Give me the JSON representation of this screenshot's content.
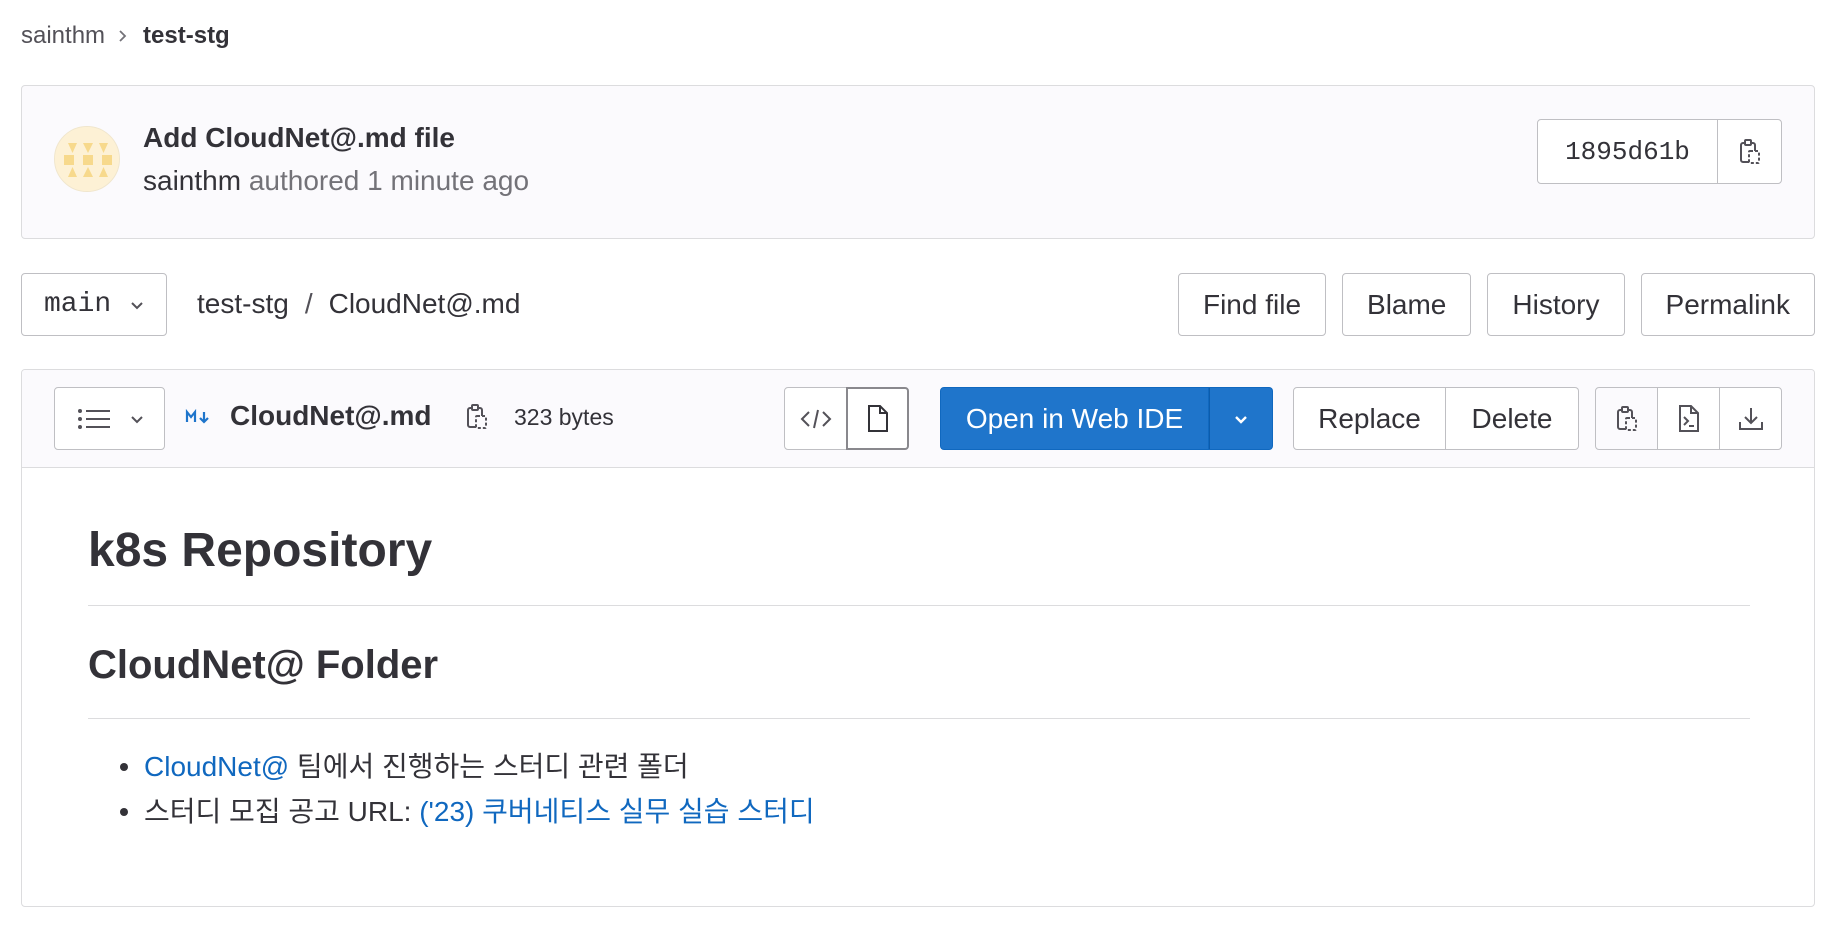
{
  "breadcrumb": {
    "parent": "sainthm",
    "current": "test-stg"
  },
  "commit": {
    "title": "Add CloudNet@.md file",
    "author": "sainthm",
    "meta": "authored 1 minute ago",
    "sha": "1895d61b"
  },
  "tree": {
    "branch": "main",
    "path_root": "test-stg",
    "path_separator": "/",
    "path_file": "CloudNet@.md",
    "actions": {
      "find_file": "Find file",
      "blame": "Blame",
      "history": "History",
      "permalink": "Permalink"
    }
  },
  "file": {
    "name": "CloudNet@.md",
    "size": "323 bytes",
    "open_web_ide": "Open in Web IDE",
    "replace": "Replace",
    "delete": "Delete"
  },
  "markdown": {
    "h1": "k8s Repository",
    "h2": "CloudNet@ Folder",
    "item1_link": "CloudNet@",
    "item1_text": " 팀에서 진행하는 스터디 관련 폴더",
    "item2_text": "스터디 모집 공고 URL: ",
    "item2_link": "('23) 쿠버네티스 실무 실습 스터디"
  },
  "colors": {
    "primary": "#1f75cb",
    "link": "#1068bf",
    "text": "#333238",
    "muted": "#737278",
    "border": "#dcdcde"
  },
  "icons": {
    "chevron": "chevron-down-icon",
    "copy": "copy-to-clipboard-icon",
    "toc": "list-bulleted-icon",
    "markdown": "markdown-icon",
    "code": "code-icon",
    "document": "document-icon",
    "terminal": "file-terminal-icon",
    "download": "download-icon"
  }
}
